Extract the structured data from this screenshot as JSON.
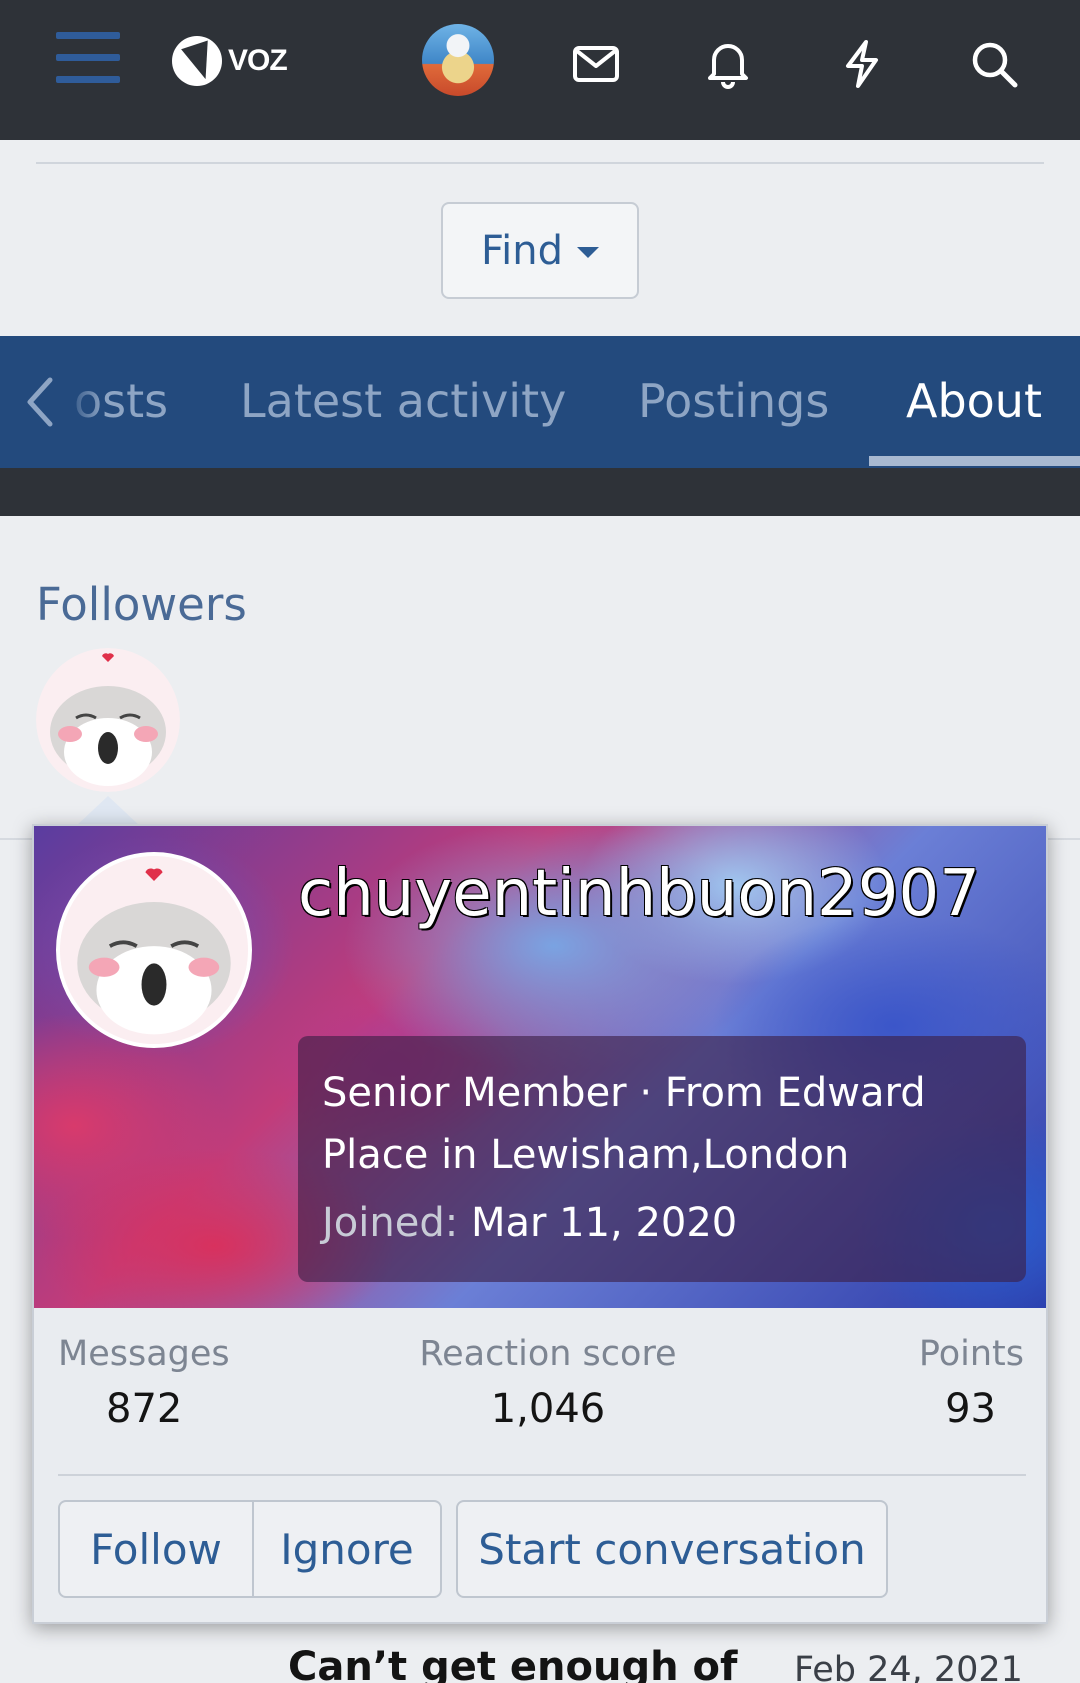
{
  "header": {
    "logo_text": "VOZ",
    "icons": [
      "menu-icon",
      "voz-logo-icon",
      "user-avatar",
      "mail-icon",
      "bell-icon",
      "bolt-icon",
      "search-icon"
    ]
  },
  "find": {
    "label": "Find"
  },
  "tabs": [
    {
      "label": "osts"
    },
    {
      "label": "Latest activity"
    },
    {
      "label": "Postings"
    },
    {
      "label": "About",
      "active": true
    }
  ],
  "followers": {
    "title": "Followers"
  },
  "member_card": {
    "username": "chuyentinhbuon2907",
    "title_location": "Senior Member · From Edward Place in Lewisham,London",
    "joined_label": "Joined:",
    "joined_value": "Mar 11, 2020",
    "stats": [
      {
        "label": "Messages",
        "value": "872"
      },
      {
        "label": "Reaction score",
        "value": "1,046"
      },
      {
        "label": "Points",
        "value": "93"
      }
    ],
    "buttons": {
      "follow": "Follow",
      "ignore": "Ignore",
      "start": "Start conversation"
    }
  },
  "peek": {
    "title": "Can’t get enough of",
    "date": "Feb 24, 2021"
  },
  "colors": {
    "topbar": "#2e3238",
    "tabbar": "#234a7d",
    "link": "#2d5d95",
    "background": "#eceef1"
  }
}
